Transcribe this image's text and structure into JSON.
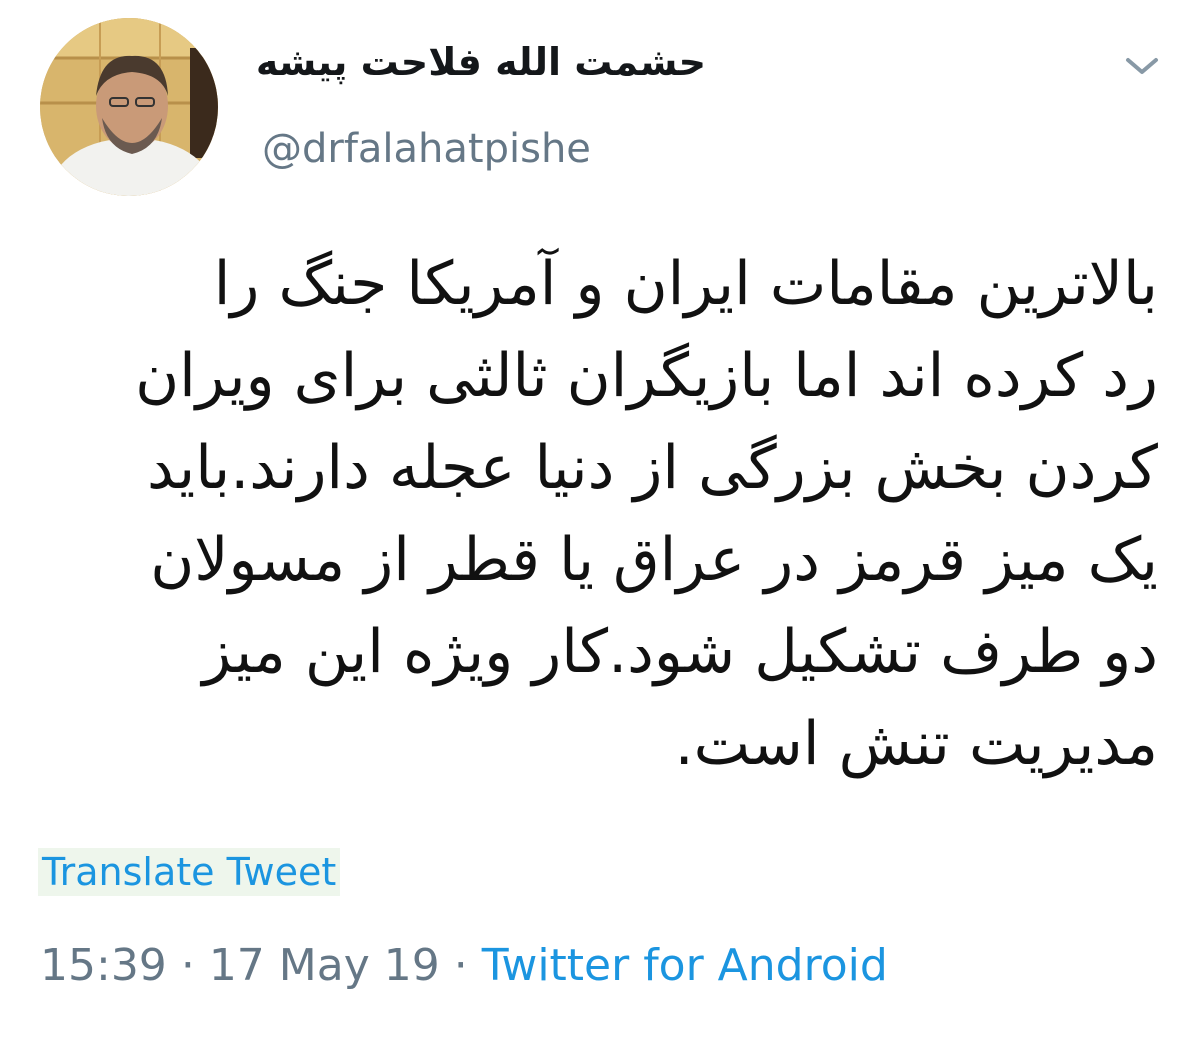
{
  "tweet": {
    "display_name": "حشمت الله فلاحت پیشه",
    "handle": "@drfalahatpishe",
    "text_lines": [
      "بالاترین مقامات ایران و آمریکا جنگ را",
      "رد کرده اند اما بازیگران ثالثی برای ویران",
      "کردن بخش بزرگی از دنیا عجله دارند.باید",
      "یک میز قرمز در عراق یا قطر از مسولان",
      "دو طرف تشکیل شود.کار ویژه این میز",
      "مدیریت تنش است."
    ],
    "translate_label": "Translate Tweet",
    "time": "15:39",
    "separator": "·",
    "date": "17 May 19",
    "source": "Twitter for Android"
  },
  "icons": {
    "menu": "chevron-down-icon",
    "avatar": "avatar"
  },
  "colors": {
    "link": "#1b95e0",
    "secondary": "#657786",
    "text": "#14171a"
  }
}
